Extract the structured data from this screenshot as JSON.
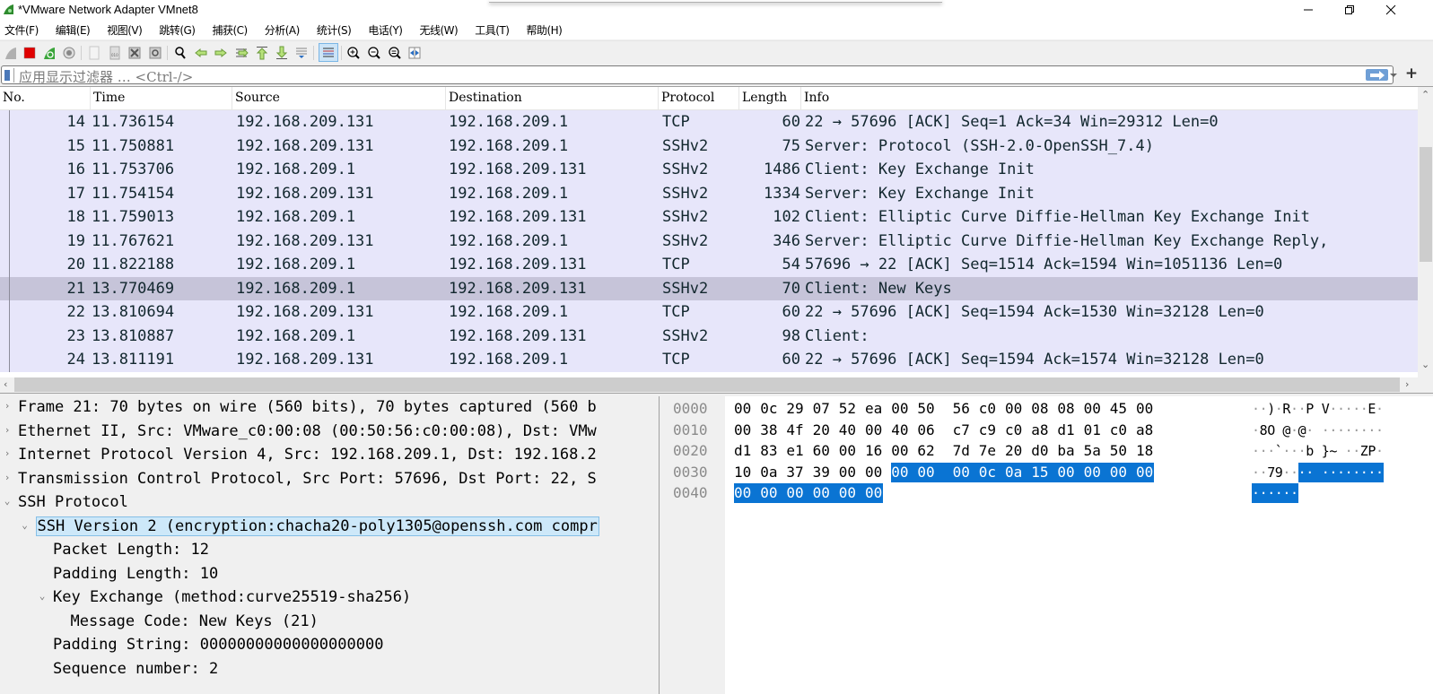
{
  "window": {
    "title": "*VMware Network Adapter VMnet8",
    "minimize_icon": "minimize-icon",
    "restore_icon": "restore-icon",
    "close_icon": "close-icon"
  },
  "menu": [
    {
      "label": "文件(F)"
    },
    {
      "label": "编辑(E)"
    },
    {
      "label": "视图(V)"
    },
    {
      "label": "跳转(G)"
    },
    {
      "label": "捕获(C)"
    },
    {
      "label": "分析(A)"
    },
    {
      "label": "统计(S)"
    },
    {
      "label": "电话(Y)"
    },
    {
      "label": "无线(W)"
    },
    {
      "label": "工具(T)"
    },
    {
      "label": "帮助(H)"
    }
  ],
  "toolbar": {
    "items": [
      "start-capture-icon",
      "stop-capture-icon",
      "restart-capture-icon",
      "capture-options-icon",
      "open-file-icon",
      "save-file-icon",
      "close-file-icon",
      "reload-file-icon",
      "find-packet-icon",
      "go-back-icon",
      "go-forward-icon",
      "go-to-packet-icon",
      "first-packet-icon",
      "last-packet-icon",
      "auto-scroll-icon",
      "colorize-icon",
      "zoom-in-icon",
      "zoom-out-icon",
      "normal-size-icon",
      "resize-columns-icon"
    ]
  },
  "filter": {
    "placeholder": "应用显示过滤器 … <Ctrl-/>",
    "value": ""
  },
  "packet_list": {
    "columns": [
      "No.",
      "Time",
      "Source",
      "Destination",
      "Protocol",
      "Length",
      "Info"
    ],
    "selected_no": "21",
    "rows": [
      {
        "no": "14",
        "time": "11.736154",
        "src": "192.168.209.131",
        "dst": "192.168.209.1",
        "proto": "TCP",
        "len": "60",
        "info": "22 → 57696 [ACK] Seq=1 Ack=34 Win=29312 Len=0"
      },
      {
        "no": "15",
        "time": "11.750881",
        "src": "192.168.209.131",
        "dst": "192.168.209.1",
        "proto": "SSHv2",
        "len": "75",
        "info": "Server: Protocol (SSH-2.0-OpenSSH_7.4)"
      },
      {
        "no": "16",
        "time": "11.753706",
        "src": "192.168.209.1",
        "dst": "192.168.209.131",
        "proto": "SSHv2",
        "len": "1486",
        "info": "Client: Key Exchange Init"
      },
      {
        "no": "17",
        "time": "11.754154",
        "src": "192.168.209.131",
        "dst": "192.168.209.1",
        "proto": "SSHv2",
        "len": "1334",
        "info": "Server: Key Exchange Init"
      },
      {
        "no": "18",
        "time": "11.759013",
        "src": "192.168.209.1",
        "dst": "192.168.209.131",
        "proto": "SSHv2",
        "len": "102",
        "info": "Client: Elliptic Curve Diffie-Hellman Key Exchange Init"
      },
      {
        "no": "19",
        "time": "11.767621",
        "src": "192.168.209.131",
        "dst": "192.168.209.1",
        "proto": "SSHv2",
        "len": "346",
        "info": "Server: Elliptic Curve Diffie-Hellman Key Exchange Reply,"
      },
      {
        "no": "20",
        "time": "11.822188",
        "src": "192.168.209.1",
        "dst": "192.168.209.131",
        "proto": "TCP",
        "len": "54",
        "info": "57696 → 22 [ACK] Seq=1514 Ack=1594 Win=1051136 Len=0"
      },
      {
        "no": "21",
        "time": "13.770469",
        "src": "192.168.209.1",
        "dst": "192.168.209.131",
        "proto": "SSHv2",
        "len": "70",
        "info": "Client: New Keys"
      },
      {
        "no": "22",
        "time": "13.810694",
        "src": "192.168.209.131",
        "dst": "192.168.209.1",
        "proto": "TCP",
        "len": "60",
        "info": "22 → 57696 [ACK] Seq=1594 Ack=1530 Win=32128 Len=0"
      },
      {
        "no": "23",
        "time": "13.810887",
        "src": "192.168.209.1",
        "dst": "192.168.209.131",
        "proto": "SSHv2",
        "len": "98",
        "info": "Client:"
      },
      {
        "no": "24",
        "time": "13.811191",
        "src": "192.168.209.131",
        "dst": "192.168.209.1",
        "proto": "TCP",
        "len": "60",
        "info": "22 → 57696 [ACK] Seq=1594 Ack=1574 Win=32128 Len=0"
      }
    ]
  },
  "details": [
    {
      "level": 0,
      "expander": "collapsed",
      "text": "Frame 21: 70 bytes on wire (560 bits), 70 bytes captured (560 b"
    },
    {
      "level": 0,
      "expander": "collapsed",
      "text": "Ethernet II, Src: VMware_c0:00:08 (00:50:56:c0:00:08), Dst: VMw"
    },
    {
      "level": 0,
      "expander": "collapsed",
      "text": "Internet Protocol Version 4, Src: 192.168.209.1, Dst: 192.168.2"
    },
    {
      "level": 0,
      "expander": "collapsed",
      "text": "Transmission Control Protocol, Src Port: 57696, Dst Port: 22, S"
    },
    {
      "level": 0,
      "expander": "expanded",
      "text": "SSH Protocol"
    },
    {
      "level": 1,
      "expander": "expanded",
      "text": "SSH Version 2 (encryption:chacha20-poly1305@openssh.com compr",
      "highlight": true
    },
    {
      "level": 2,
      "expander": "none",
      "text": "Packet Length: 12"
    },
    {
      "level": 2,
      "expander": "none",
      "text": "Padding Length: 10"
    },
    {
      "level": 2,
      "expander": "expanded",
      "text": "Key Exchange (method:curve25519-sha256)"
    },
    {
      "level": 3,
      "expander": "none",
      "text": "Message Code: New Keys (21)"
    },
    {
      "level": 2,
      "expander": "none",
      "text": "Padding String: 00000000000000000000"
    },
    {
      "level": 2,
      "expander": "none",
      "text": "Sequence number: 2"
    }
  ],
  "bytes": [
    {
      "offset": "0000",
      "hex1": "00 0c 29 07 52 ea 00 50",
      "hex2": "56 c0 00 08 08 00 45 00",
      "ascii1": "··)·R··P",
      "ascii2": "V·····E·",
      "sel_from": null
    },
    {
      "offset": "0010",
      "hex1": "00 38 4f 20 40 00 40 06",
      "hex2": "c7 c9 c0 a8 d1 01 c0 a8",
      "ascii1": "·8O @·@·",
      "ascii2": "········",
      "sel_from": null
    },
    {
      "offset": "0020",
      "hex1": "d1 83 e1 60 00 16 00 62",
      "hex2": "7d 7e 20 d0 ba 5a 50 18",
      "ascii1": "···`···b",
      "ascii2": "}~ ··ZP·",
      "sel_from": null
    },
    {
      "offset": "0030",
      "hex1": "10 0a 37 39 00 00 00 00",
      "hex2": "00 0c 0a 15 00 00 00 00",
      "ascii1": "··79····",
      "ascii2": "········",
      "sel_from": 6
    },
    {
      "offset": "0040",
      "hex1": "00 00 00 00 00 00",
      "hex2": "",
      "ascii1": "······",
      "ascii2": "",
      "sel_from": 0
    }
  ],
  "colors": {
    "row_bg": "#e7e6fa",
    "row_selected_bg": "#c6c4d9",
    "bytes_selection": "#0a74d3",
    "tree_highlight": "#cde8f9"
  }
}
